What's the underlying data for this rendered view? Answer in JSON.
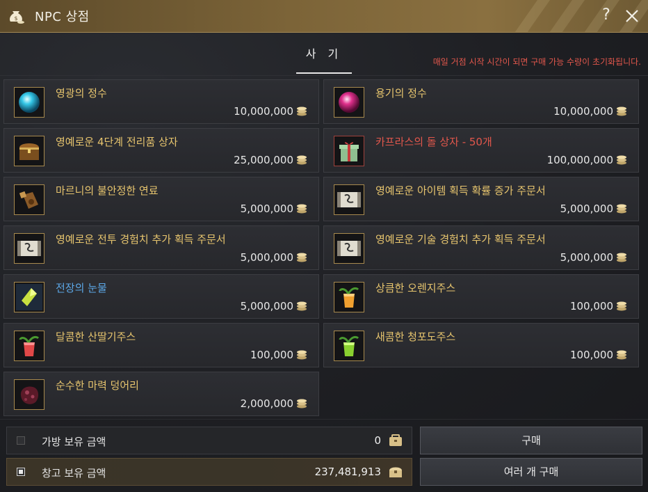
{
  "window": {
    "title": "NPC 상점"
  },
  "tab": {
    "label": "사 기"
  },
  "notice": "매일 거점 시작 시간이 되면 구매 가능 수량이 초기화됩니다.",
  "items": [
    {
      "name": "영광의 정수",
      "price": "10,000,000",
      "icon": "cyan-orb-icon",
      "name_color": "gold"
    },
    {
      "name": "용기의 정수",
      "price": "10,000,000",
      "icon": "magenta-orb-icon",
      "name_color": "gold"
    },
    {
      "name": "영예로운 4단계 전리품 상자",
      "price": "25,000,000",
      "icon": "treasure-chest-icon",
      "name_color": "gold"
    },
    {
      "name": "카프라스의 돌 상자 - 50개",
      "price": "100,000,000",
      "icon": "gift-box-icon",
      "name_color": "red"
    },
    {
      "name": "마르니의 불안정한 연료",
      "price": "5,000,000",
      "icon": "fuel-bottle-icon",
      "name_color": "gold"
    },
    {
      "name": "영예로운 아이템 획득 확률 증가 주문서",
      "price": "5,000,000",
      "icon": "scroll-icon",
      "name_color": "gold"
    },
    {
      "name": "영예로운 전투 경험치 추가 획득 주문서",
      "price": "5,000,000",
      "icon": "scroll-icon",
      "name_color": "gold"
    },
    {
      "name": "영예로운 기술 경험치 추가 획득 주문서",
      "price": "5,000,000",
      "icon": "scroll-icon",
      "name_color": "gold"
    },
    {
      "name": "전장의 눈물",
      "price": "5,000,000",
      "icon": "green-crystal-icon",
      "name_color": "blue"
    },
    {
      "name": "상큼한 오렌지주스",
      "price": "100,000",
      "icon": "orange-juice-icon",
      "name_color": "gold"
    },
    {
      "name": "달콤한 산딸기주스",
      "price": "100,000",
      "icon": "raspberry-juice-icon",
      "name_color": "gold"
    },
    {
      "name": "새콤한 청포도주스",
      "price": "100,000",
      "icon": "grape-juice-icon",
      "name_color": "gold"
    },
    {
      "name": "순수한 마력 덩어리",
      "price": "2,000,000",
      "icon": "magic-lump-icon",
      "name_color": "gold"
    }
  ],
  "wallet": {
    "bag": {
      "label": "가방 보유 금액",
      "amount": "0",
      "checked": false
    },
    "storage": {
      "label": "창고 보유 금액",
      "amount": "237,481,913",
      "checked": true
    }
  },
  "buttons": {
    "buy": "구매",
    "buy_multiple": "여러 개 구매"
  },
  "colors": {
    "gold": "#e7c56e",
    "red": "#e2574c",
    "blue": "#5ca8e8",
    "title_bar": "#7c6438"
  }
}
